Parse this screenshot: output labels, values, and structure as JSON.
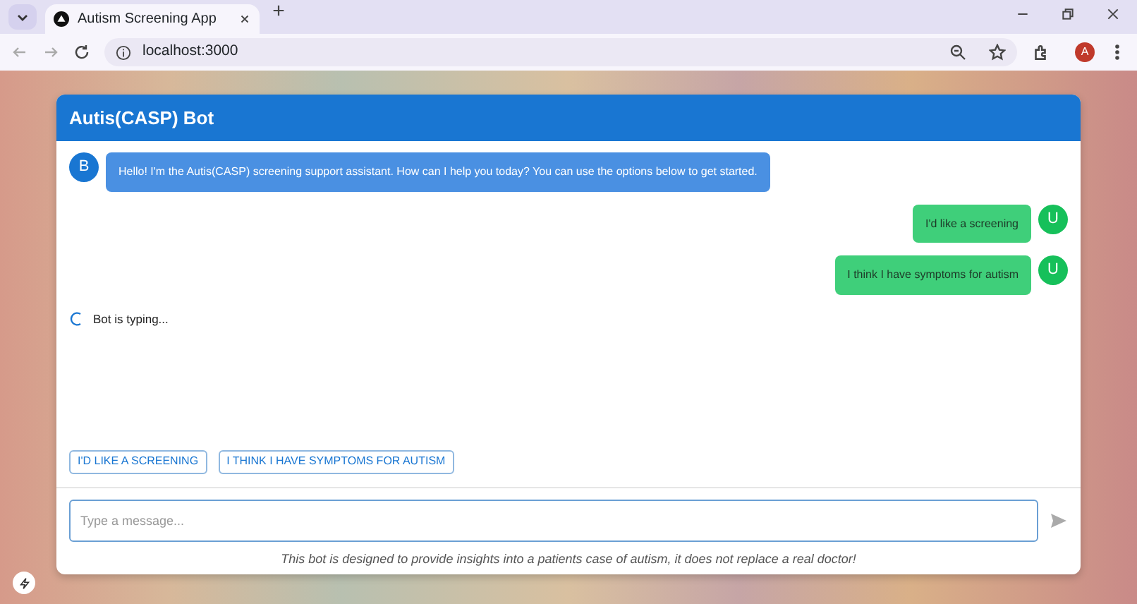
{
  "browser": {
    "tab_title": "Autism Screening App",
    "address": "localhost:3000",
    "profile_initial": "A"
  },
  "chat": {
    "title": "Autis(CASP) Bot",
    "messages": [
      {
        "kind": "bot",
        "avatar": "B",
        "text": "Hello! I'm the Autis(CASP) screening support assistant. How can I help you today? You can use the options below to get started."
      },
      {
        "kind": "user",
        "avatar": "U",
        "text": "I'd like a screening"
      },
      {
        "kind": "user",
        "avatar": "U",
        "text": "I think I have symptoms for autism"
      }
    ],
    "typing": "Bot is typing...",
    "quick_replies": [
      "I'D LIKE A SCREENING",
      "I THINK I HAVE SYMPTOMS FOR AUTISM"
    ],
    "input": {
      "placeholder": "Type a message..."
    },
    "disclaimer": "This bot is designed to provide insights into a patients case of autism, it does not replace a real doctor!"
  }
}
